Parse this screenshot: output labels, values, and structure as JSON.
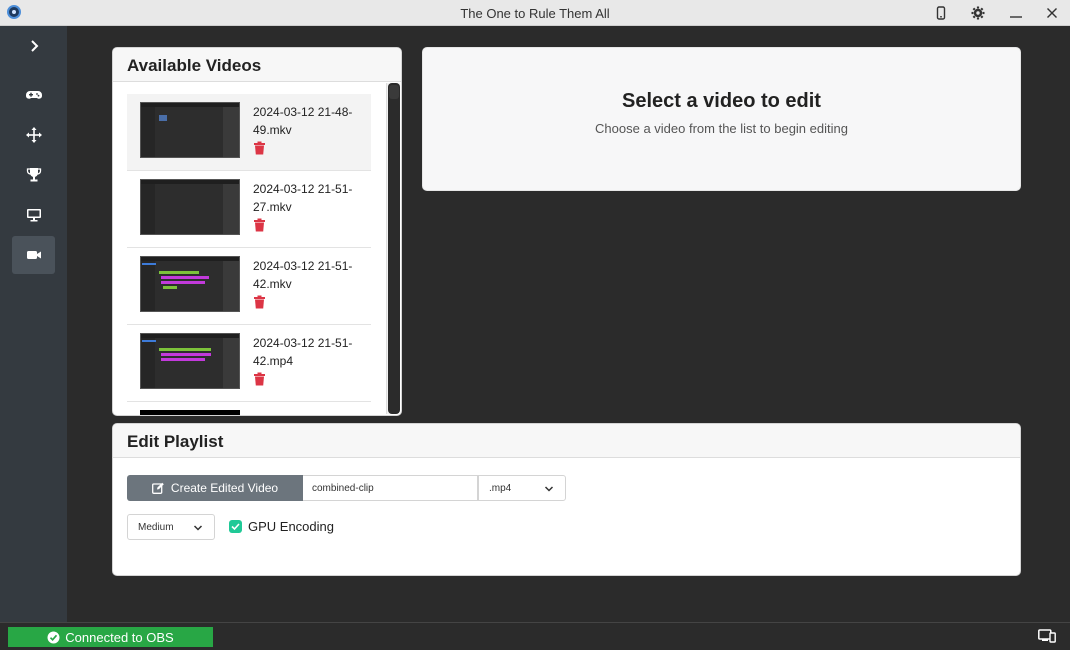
{
  "window": {
    "title": "The One to Rule Them All",
    "icons": [
      "app-logo",
      "phone-icon",
      "gear-icon",
      "minimize-icon",
      "close-icon"
    ]
  },
  "sidebar": {
    "items": [
      {
        "icon": "chevron-right-icon",
        "active": false
      },
      {
        "icon": "gamepad-icon",
        "active": false
      },
      {
        "icon": "move-arrows-icon",
        "active": false
      },
      {
        "icon": "trophy-icon",
        "active": false
      },
      {
        "icon": "monitor-icon",
        "active": false
      },
      {
        "icon": "video-camera-icon",
        "active": true
      }
    ]
  },
  "available_videos": {
    "title": "Available Videos",
    "items": [
      {
        "name_line1": "2024-03-12 21-48-",
        "name_line2": "49.mkv",
        "selected": true,
        "thumb_style": "plain"
      },
      {
        "name_line1": "2024-03-12 21-51-",
        "name_line2": "27.mkv",
        "selected": false,
        "thumb_style": "plain"
      },
      {
        "name_line1": "2024-03-12 21-51-",
        "name_line2": "42.mkv",
        "selected": false,
        "thumb_style": "timeline"
      },
      {
        "name_line1": "2024-03-12 21-51-",
        "name_line2": "42.mp4",
        "selected": false,
        "thumb_style": "timeline"
      }
    ]
  },
  "editor_placeholder": {
    "title": "Select a video to edit",
    "subtitle": "Choose a video from the list to begin editing"
  },
  "edit_playlist": {
    "title": "Edit Playlist",
    "create_button_label": "Create Edited Video",
    "filename_value": "combined-clip",
    "extension_selected": ".mp4",
    "quality_selected": "Medium",
    "gpu_encoding_label": "GPU Encoding",
    "gpu_encoding_checked": true
  },
  "status_bar": {
    "connection_text": "Connected to OBS",
    "connection_color": "#28a745"
  },
  "colors": {
    "sidebar_bg": "#343a40",
    "main_bg": "#2b2b2b",
    "delete_red": "#dc3545",
    "button_gray": "#6c757d",
    "check_teal": "#20c997"
  }
}
